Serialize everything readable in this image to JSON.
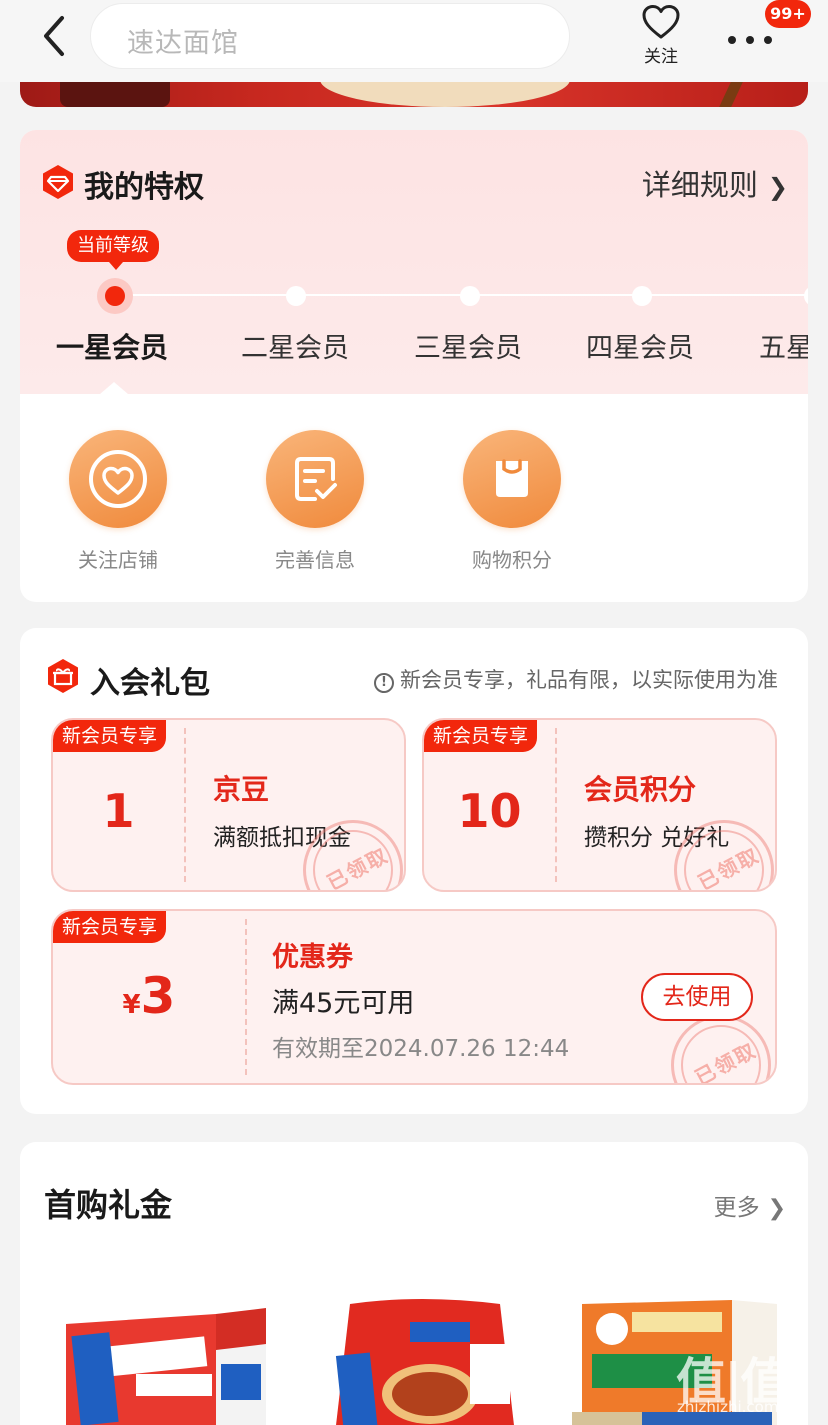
{
  "header": {
    "search_placeholder": "速达面馆",
    "follow_label": "关注",
    "notification_badge": "99+"
  },
  "privileges": {
    "title": "我的特权",
    "rules_label": "详细规则",
    "rules_arrow": "❯",
    "current_tag": "当前等级",
    "levels": [
      "一星会员",
      "二星会员",
      "三星会员",
      "四星会员",
      "五星"
    ],
    "perks": [
      {
        "label": "关注店铺",
        "icon": "heart-circle-icon"
      },
      {
        "label": "完善信息",
        "icon": "form-check-icon"
      },
      {
        "label": "购物积分",
        "icon": "shopping-bag-icon"
      }
    ]
  },
  "gift": {
    "title": "入会礼包",
    "note": "新会员专享，礼品有限，以实际使用为准",
    "note_icon": "!",
    "coupons": [
      {
        "tag": "新会员专享",
        "amount": "1",
        "name": "京豆",
        "desc": "满额抵扣现金",
        "stamp": "已领取"
      },
      {
        "tag": "新会员专享",
        "amount": "10",
        "name": "会员积分",
        "desc": "攒积分 兑好礼",
        "stamp": "已领取"
      }
    ],
    "voucher": {
      "tag": "新会员专享",
      "currency": "¥",
      "amount": "3",
      "name": "优惠券",
      "condition": "满45元可用",
      "expiry": "有效期至2024.07.26 12:44",
      "button": "去使用",
      "stamp": "已领取"
    }
  },
  "first_purchase": {
    "title": "首购礼金",
    "more_label": "更多",
    "more_arrow": "❯"
  },
  "watermark": {
    "text": "值|值|值",
    "url": "zhizhizhi.com"
  },
  "colors": {
    "accent": "#f2270c",
    "perk_orange": "#f08a3c",
    "coupon_bg": "#fef1f0"
  }
}
